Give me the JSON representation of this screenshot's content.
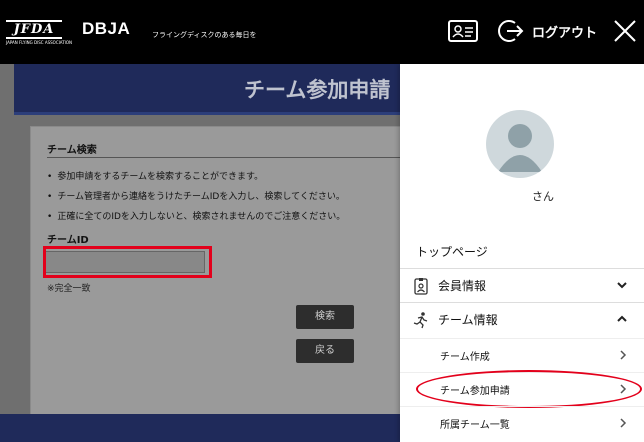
{
  "header": {
    "logo_primary": "JFDA",
    "logo_primary_sub": "JAPAN FLYING DISC ASSOCIATION",
    "logo_secondary": "DBJA",
    "tagline": "フライングディスクのある毎日を",
    "logout_label": "ログアウト",
    "icons": [
      "id-card-icon",
      "logout-icon",
      "close-icon"
    ]
  },
  "background_page": {
    "banner_title": "チーム参加申請",
    "card_title": "チーム検索",
    "bullets": [
      "参加申請をするチームを検索することができます。",
      "チーム管理者から連絡をうけたチームIDを入力し、検索してください。",
      "正確に全てのIDを入力しないと、検索されませんのでご注意ください。"
    ],
    "id_label": "チームID",
    "id_input_value": "",
    "hint": "※完全一致",
    "search_button": "検索",
    "back_button": "戻る"
  },
  "drawer": {
    "user_suffix": "さん",
    "items": [
      {
        "label": "トップページ"
      },
      {
        "label": "会員情報",
        "icon": "id-badge-icon",
        "expanded": false
      },
      {
        "label": "チーム情報",
        "icon": "running-person-icon",
        "expanded": true
      }
    ],
    "sub_items": [
      {
        "label": "チーム作成"
      },
      {
        "label": "チーム参加申請"
      },
      {
        "label": "所属チーム一覧"
      }
    ]
  },
  "colors": {
    "header_bg": "#000000",
    "banner_bg": "#1f2a5a",
    "highlight_red": "#e3001b",
    "button_dark": "#2d2d2d"
  }
}
